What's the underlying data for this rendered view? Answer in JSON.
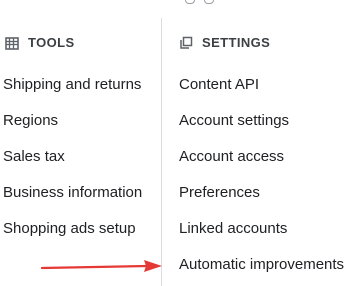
{
  "tools": {
    "icon": "table-icon",
    "title": "TOOLS",
    "items": [
      {
        "label": "Shipping and returns"
      },
      {
        "label": "Regions"
      },
      {
        "label": "Sales tax"
      },
      {
        "label": "Business information"
      },
      {
        "label": "Shopping ads setup"
      }
    ]
  },
  "settings": {
    "icon": "copy-stack-icon",
    "title": "SETTINGS",
    "items": [
      {
        "label": "Content API"
      },
      {
        "label": "Account settings"
      },
      {
        "label": "Account access"
      },
      {
        "label": "Preferences"
      },
      {
        "label": "Linked accounts"
      },
      {
        "label": "Automatic improvements"
      }
    ]
  },
  "annotation": {
    "type": "arrow",
    "color": "#e53935",
    "points_to": "Automatic improvements"
  }
}
